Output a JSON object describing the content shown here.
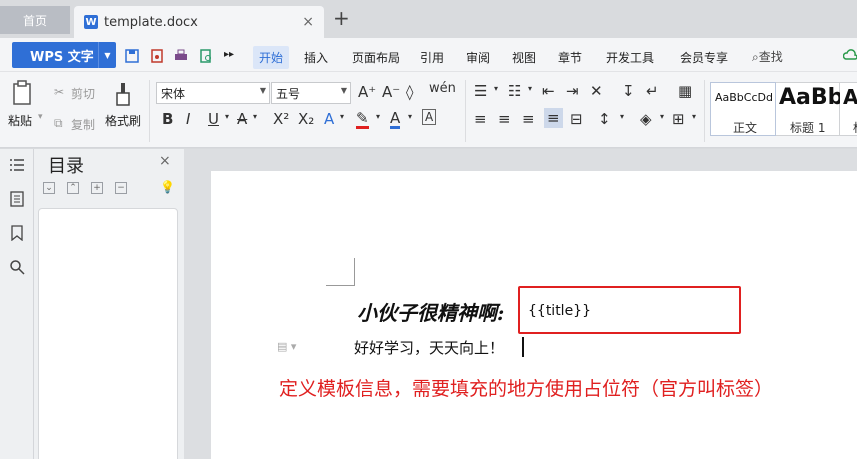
{
  "tabs": {
    "home": "首页",
    "doc_name": "template.docx",
    "doc_icon_letter": "W",
    "close": "×",
    "new_tab": "+"
  },
  "menu": {
    "wps_label": "WPS 文字",
    "items": [
      "开始",
      "插入",
      "页面布局",
      "引用",
      "审阅",
      "视图",
      "章节",
      "开发工具",
      "会员专享"
    ],
    "search": "查找"
  },
  "ribbon": {
    "paste": "粘贴",
    "cut": "剪切",
    "copy": "复制",
    "format_painter": "格式刷",
    "font_name": "宋体",
    "font_size": "五号",
    "styles": [
      {
        "sample": "AaBbCcDd",
        "name": "正文"
      },
      {
        "sample": "AaBb",
        "name": "标题 1"
      },
      {
        "sample": "A",
        "name": "标"
      }
    ]
  },
  "navigation": {
    "title": "目录",
    "close": "×"
  },
  "document": {
    "heading": "小伙子很精神啊:",
    "placeholder": "{{title}}",
    "body": "好好学习，天天向上！",
    "annotation": "定义模板信息，需要填充的地方使用占位符（官方叫标签）"
  },
  "colors": {
    "accent": "#2f6fd6",
    "annotation_red": "#e02020"
  }
}
